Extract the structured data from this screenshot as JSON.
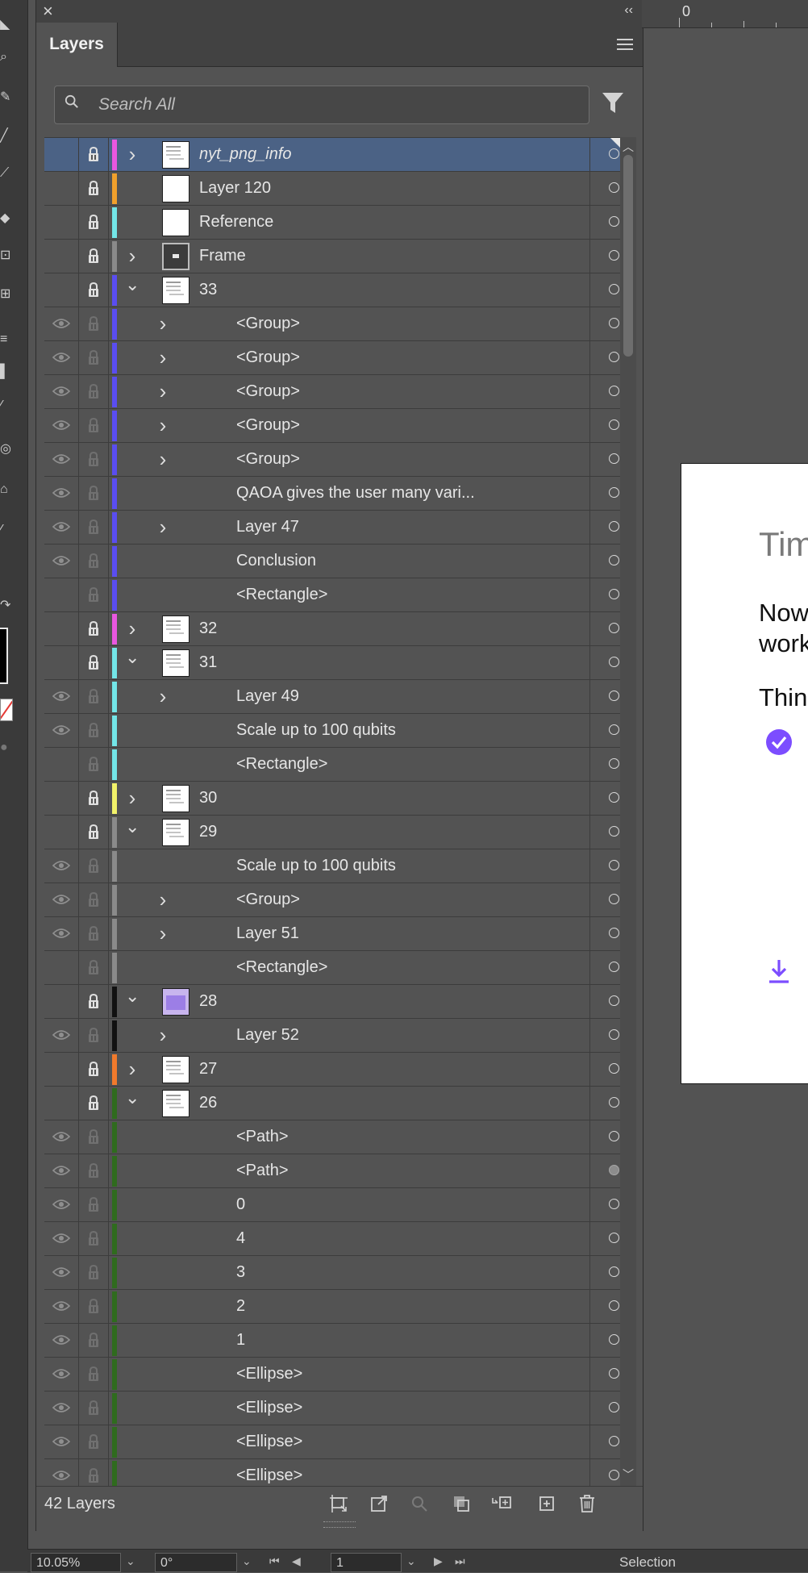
{
  "panel": {
    "tab_label": "Layers",
    "search_placeholder": "Search All",
    "layer_count": "42 Layers"
  },
  "colors": {
    "panel_bg": "#535353",
    "selected_row": "#4b6285",
    "accent_purple": "#7c4dff"
  },
  "layers": [
    {
      "name": "nyt_png_info",
      "depth": 0,
      "expander": "collapsed",
      "thumb": "page",
      "visible": false,
      "locked": true,
      "color": "#e957e0",
      "italic": true,
      "selected": true,
      "target_filled": false
    },
    {
      "name": "Layer 120",
      "depth": 0,
      "expander": "none",
      "thumb": "blank",
      "visible": false,
      "locked": true,
      "color": "#f0a02c",
      "italic": false,
      "selected": false,
      "target_filled": false
    },
    {
      "name": "Reference",
      "depth": 0,
      "expander": "none",
      "thumb": "blank",
      "visible": false,
      "locked": true,
      "color": "#73e6e8",
      "italic": false,
      "selected": false,
      "target_filled": false
    },
    {
      "name": "Frame",
      "depth": 0,
      "expander": "collapsed",
      "thumb": "dark",
      "visible": false,
      "locked": true,
      "color": "#8a8a8a",
      "italic": false,
      "selected": false,
      "target_filled": false
    },
    {
      "name": "33",
      "depth": 0,
      "expander": "expanded",
      "thumb": "page",
      "visible": false,
      "locked": true,
      "color": "#5a4df0",
      "italic": false,
      "selected": false,
      "target_filled": false
    },
    {
      "name": "<Group>",
      "depth": 1,
      "expander": "collapsed",
      "thumb": "none",
      "visible": true,
      "locked": false,
      "color": "#5a4df0",
      "italic": false,
      "selected": false,
      "target_filled": false
    },
    {
      "name": "<Group>",
      "depth": 1,
      "expander": "collapsed",
      "thumb": "none",
      "visible": true,
      "locked": false,
      "color": "#5a4df0",
      "italic": false,
      "selected": false,
      "target_filled": false
    },
    {
      "name": "<Group>",
      "depth": 1,
      "expander": "collapsed",
      "thumb": "none",
      "visible": true,
      "locked": false,
      "color": "#5a4df0",
      "italic": false,
      "selected": false,
      "target_filled": false
    },
    {
      "name": "<Group>",
      "depth": 1,
      "expander": "collapsed",
      "thumb": "none",
      "visible": true,
      "locked": false,
      "color": "#5a4df0",
      "italic": false,
      "selected": false,
      "target_filled": false
    },
    {
      "name": "<Group>",
      "depth": 1,
      "expander": "collapsed",
      "thumb": "none",
      "visible": true,
      "locked": false,
      "color": "#5a4df0",
      "italic": false,
      "selected": false,
      "target_filled": false
    },
    {
      "name": "QAOA gives the user many vari...",
      "depth": 1,
      "expander": "none",
      "thumb": "none",
      "visible": true,
      "locked": false,
      "color": "#5a4df0",
      "italic": false,
      "selected": false,
      "target_filled": false
    },
    {
      "name": "Layer 47",
      "depth": 1,
      "expander": "collapsed",
      "thumb": "none",
      "visible": true,
      "locked": false,
      "color": "#5a4df0",
      "italic": false,
      "selected": false,
      "target_filled": false
    },
    {
      "name": "Conclusion",
      "depth": 1,
      "expander": "none",
      "thumb": "none",
      "visible": true,
      "locked": false,
      "color": "#5a4df0",
      "italic": false,
      "selected": false,
      "target_filled": false
    },
    {
      "name": "<Rectangle>",
      "depth": 1,
      "expander": "none",
      "thumb": "none",
      "visible": false,
      "locked": false,
      "color": "#5a4df0",
      "italic": false,
      "selected": false,
      "target_filled": false
    },
    {
      "name": "32",
      "depth": 0,
      "expander": "collapsed",
      "thumb": "page",
      "visible": false,
      "locked": true,
      "color": "#e957e0",
      "italic": false,
      "selected": false,
      "target_filled": false
    },
    {
      "name": "31",
      "depth": 0,
      "expander": "expanded",
      "thumb": "page",
      "visible": false,
      "locked": true,
      "color": "#73e6e8",
      "italic": false,
      "selected": false,
      "target_filled": false
    },
    {
      "name": "Layer 49",
      "depth": 1,
      "expander": "collapsed",
      "thumb": "none",
      "visible": true,
      "locked": false,
      "color": "#73e6e8",
      "italic": false,
      "selected": false,
      "target_filled": false
    },
    {
      "name": "Scale up to 100 qubits",
      "depth": 1,
      "expander": "none",
      "thumb": "none",
      "visible": true,
      "locked": false,
      "color": "#73e6e8",
      "italic": false,
      "selected": false,
      "target_filled": false
    },
    {
      "name": "<Rectangle>",
      "depth": 1,
      "expander": "none",
      "thumb": "none",
      "visible": false,
      "locked": false,
      "color": "#73e6e8",
      "italic": false,
      "selected": false,
      "target_filled": false
    },
    {
      "name": "30",
      "depth": 0,
      "expander": "collapsed",
      "thumb": "page",
      "visible": false,
      "locked": true,
      "color": "#f2f26a",
      "italic": false,
      "selected": false,
      "target_filled": false
    },
    {
      "name": "29",
      "depth": 0,
      "expander": "expanded",
      "thumb": "page",
      "visible": false,
      "locked": true,
      "color": "#8a8a8a",
      "italic": false,
      "selected": false,
      "target_filled": false
    },
    {
      "name": "Scale up to 100 qubits",
      "depth": 1,
      "expander": "none",
      "thumb": "none",
      "visible": true,
      "locked": false,
      "color": "#8a8a8a",
      "italic": false,
      "selected": false,
      "target_filled": false
    },
    {
      "name": "<Group>",
      "depth": 1,
      "expander": "collapsed",
      "thumb": "none",
      "visible": true,
      "locked": false,
      "color": "#8a8a8a",
      "italic": false,
      "selected": false,
      "target_filled": false
    },
    {
      "name": "Layer 51",
      "depth": 1,
      "expander": "collapsed",
      "thumb": "none",
      "visible": true,
      "locked": false,
      "color": "#8a8a8a",
      "italic": false,
      "selected": false,
      "target_filled": false
    },
    {
      "name": "<Rectangle>",
      "depth": 1,
      "expander": "none",
      "thumb": "none",
      "visible": false,
      "locked": false,
      "color": "#8a8a8a",
      "italic": false,
      "selected": false,
      "target_filled": false
    },
    {
      "name": "28",
      "depth": 0,
      "expander": "expanded",
      "thumb": "purple",
      "visible": false,
      "locked": true,
      "color": "#111111",
      "italic": false,
      "selected": false,
      "target_filled": false
    },
    {
      "name": "Layer 52",
      "depth": 1,
      "expander": "collapsed",
      "thumb": "none",
      "visible": true,
      "locked": false,
      "color": "#111111",
      "italic": false,
      "selected": false,
      "target_filled": false
    },
    {
      "name": "27",
      "depth": 0,
      "expander": "collapsed",
      "thumb": "page",
      "visible": false,
      "locked": true,
      "color": "#f07a2c",
      "italic": false,
      "selected": false,
      "target_filled": false
    },
    {
      "name": "26",
      "depth": 0,
      "expander": "expanded",
      "thumb": "page",
      "visible": false,
      "locked": true,
      "color": "#2f6b1e",
      "italic": false,
      "selected": false,
      "target_filled": false
    },
    {
      "name": "<Path>",
      "depth": 1,
      "expander": "none",
      "thumb": "none",
      "visible": true,
      "locked": false,
      "color": "#2f6b1e",
      "italic": false,
      "selected": false,
      "target_filled": false
    },
    {
      "name": "<Path>",
      "depth": 1,
      "expander": "none",
      "thumb": "none",
      "visible": true,
      "locked": false,
      "color": "#2f6b1e",
      "italic": false,
      "selected": false,
      "target_filled": true
    },
    {
      "name": "0",
      "depth": 1,
      "expander": "none",
      "thumb": "none",
      "visible": true,
      "locked": false,
      "color": "#2f6b1e",
      "italic": false,
      "selected": false,
      "target_filled": false
    },
    {
      "name": "4",
      "depth": 1,
      "expander": "none",
      "thumb": "none",
      "visible": true,
      "locked": false,
      "color": "#2f6b1e",
      "italic": false,
      "selected": false,
      "target_filled": false
    },
    {
      "name": "3",
      "depth": 1,
      "expander": "none",
      "thumb": "none",
      "visible": true,
      "locked": false,
      "color": "#2f6b1e",
      "italic": false,
      "selected": false,
      "target_filled": false
    },
    {
      "name": "2",
      "depth": 1,
      "expander": "none",
      "thumb": "none",
      "visible": true,
      "locked": false,
      "color": "#2f6b1e",
      "italic": false,
      "selected": false,
      "target_filled": false
    },
    {
      "name": "1",
      "depth": 1,
      "expander": "none",
      "thumb": "none",
      "visible": true,
      "locked": false,
      "color": "#2f6b1e",
      "italic": false,
      "selected": false,
      "target_filled": false
    },
    {
      "name": "<Ellipse>",
      "depth": 1,
      "expander": "none",
      "thumb": "none",
      "visible": true,
      "locked": false,
      "color": "#2f6b1e",
      "italic": false,
      "selected": false,
      "target_filled": false
    },
    {
      "name": "<Ellipse>",
      "depth": 1,
      "expander": "none",
      "thumb": "none",
      "visible": true,
      "locked": false,
      "color": "#2f6b1e",
      "italic": false,
      "selected": false,
      "target_filled": false
    },
    {
      "name": "<Ellipse>",
      "depth": 1,
      "expander": "none",
      "thumb": "none",
      "visible": true,
      "locked": false,
      "color": "#2f6b1e",
      "italic": false,
      "selected": false,
      "target_filled": false
    },
    {
      "name": "<Ellipse>",
      "depth": 1,
      "expander": "none",
      "thumb": "none",
      "visible": true,
      "locked": false,
      "color": "#2f6b1e",
      "italic": false,
      "selected": false,
      "target_filled": false
    }
  ],
  "canvas": {
    "ruler_zero": "0",
    "artboard_title": "Tim",
    "artboard_line1": "Now",
    "artboard_line2": "work",
    "artboard_line3": "Thin"
  },
  "statusbar": {
    "zoom": "10.05%",
    "rotation": "0°",
    "artboard_number": "1",
    "tool": "Selection"
  },
  "icons": {
    "search": "search-icon",
    "filter": "filter-icon",
    "menu": "panel-menu-icon",
    "eye": "eye-icon",
    "lock": "lock-icon",
    "target": "target-circle-icon"
  }
}
